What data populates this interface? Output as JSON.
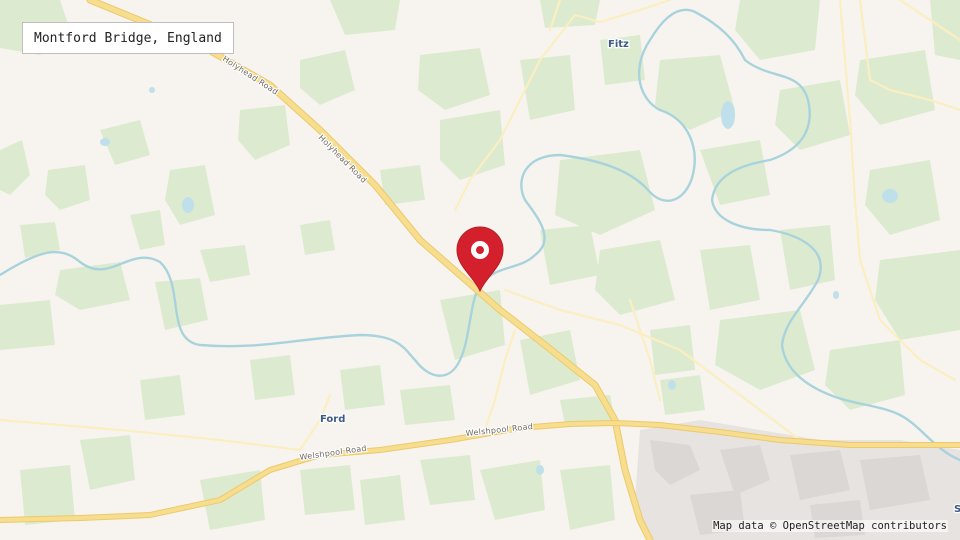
{
  "location": {
    "title": "Montford Bridge, England"
  },
  "places": {
    "fitz": "Fitz",
    "ford": "Ford",
    "edge_fragment": "S"
  },
  "roads": {
    "holyhead_1": "Holyhead Road",
    "holyhead_2": "Holyhead Road",
    "welshpool_1": "Welshpool Road",
    "welshpool_2": "Welshpool Road"
  },
  "attribution": "Map data © OpenStreetMap contributors",
  "icons": {
    "marker": "map-pin-icon"
  },
  "colors": {
    "background": "#f7f4ef",
    "woodland": "#dcebcf",
    "river": "#a9d3dc",
    "water": "#bfe0ea",
    "major_road": "#f6de8e",
    "minor_road": "#fbeec1",
    "urban": "#e4e2e1",
    "marker": "#d4202c",
    "label": "#3c5a86"
  }
}
